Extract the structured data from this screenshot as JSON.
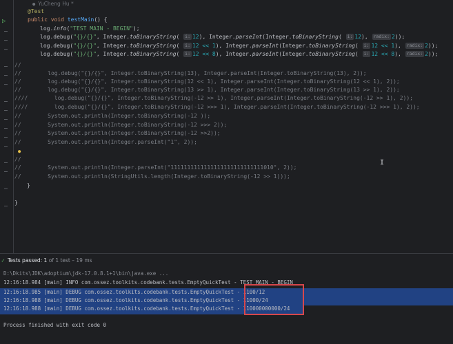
{
  "editor": {
    "author": "YuCheng Hu *",
    "annotation": "@Test",
    "kw_public": "public",
    "kw_void": "void",
    "method_name": "testMain",
    "method_tail": "() {",
    "hint_i": "i:",
    "hint_radix": "radix:",
    "log_info_lead": "log.",
    "log_info_fn": "info",
    "log_info_str": "\"TEST MAIN - BEGIN\"",
    "log_info_end": ");",
    "log_debug_lead": "log.",
    "log_debug_fn": "debug",
    "fmt_str": "\"{}/{}\"",
    "integer": "Integer.",
    "to_binary": "toBinaryString",
    "parse_int": "parseInt",
    "d1_arg": "12",
    "d2_arg": "12 << 1",
    "d3_arg": "12 << 8",
    "radix_val": "2",
    "comments": [
      "//",
      "//        log.debug(\"{}/{}\", Integer.toBinaryString(13), Integer.parseInt(Integer.toBinaryString(13), 2));",
      "//        log.debug(\"{}/{}\", Integer.toBinaryString(12 << 1), Integer.parseInt(Integer.toBinaryString(12 << 1), 2));",
      "//        log.debug(\"{}/{}\", Integer.toBinaryString(13 >> 1), Integer.parseInt(Integer.toBinaryString(13 >> 1), 2));",
      "////        log.debug(\"{}/{}\", Integer.toBinaryString(-12 >> 1), Integer.parseInt(Integer.toBinaryString(-12 >> 1), 2));",
      "////        log.debug(\"{}/{}\", Integer.toBinaryString(-12 >>> 1), Integer.parseInt(Integer.toBinaryString(-12 >>> 1), 2));",
      "//        System.out.println(Integer.toBinaryString(-12 ));",
      "//        System.out.println(Integer.toBinaryString(-12 >>> 2));",
      "//        System.out.println(Integer.toBinaryString(-12 >>2));",
      "//        System.out.println(Integer.parseInt(\"1\", 2));",
      "//",
      "//        System.out.println(Integer.parseInt(\"1111111111111111111111111111010\", 2));",
      "//        System.out.println(StringUtils.length(Integer.toBinaryString(-12 >> 1)));"
    ],
    "close_method": "}",
    "close_class": "}"
  },
  "test_panel": {
    "status_label": "Tests passed:",
    "passed": "1",
    "status_rest": "of 1 test – 19 ms"
  },
  "console": {
    "command": "D:\\Dkits\\JDK\\adoptium\\jdk-17.0.8.1+1\\bin\\java.exe ...",
    "lines": [
      "12:16:18.984 [main] INFO com.ossez.toolkits.codebank.tests.EmptyQuickTest - TEST MAIN - BEGIN",
      "12:16:18.985 [main] DEBUG com.ossez.toolkits.codebank.tests.EmptyQuickTest - 1100/12",
      "12:16:18.988 [main] DEBUG com.ossez.toolkits.codebank.tests.EmptyQuickTest - 11000/24",
      "12:16:18.988 [main] DEBUG com.ossez.toolkits.codebank.tests.EmptyQuickTest - 110000000000/24"
    ],
    "exit": "Process finished with exit code 0"
  },
  "colors": {
    "background": "#1e1f22",
    "selection": "#214283",
    "highlight_border": "#d7474b",
    "pass_green": "#5fb865"
  },
  "icons": {
    "run": "run-gutter-icon",
    "bulb": "lightbulb-icon",
    "pass": "check-icon",
    "cursor": "text-cursor-icon"
  }
}
